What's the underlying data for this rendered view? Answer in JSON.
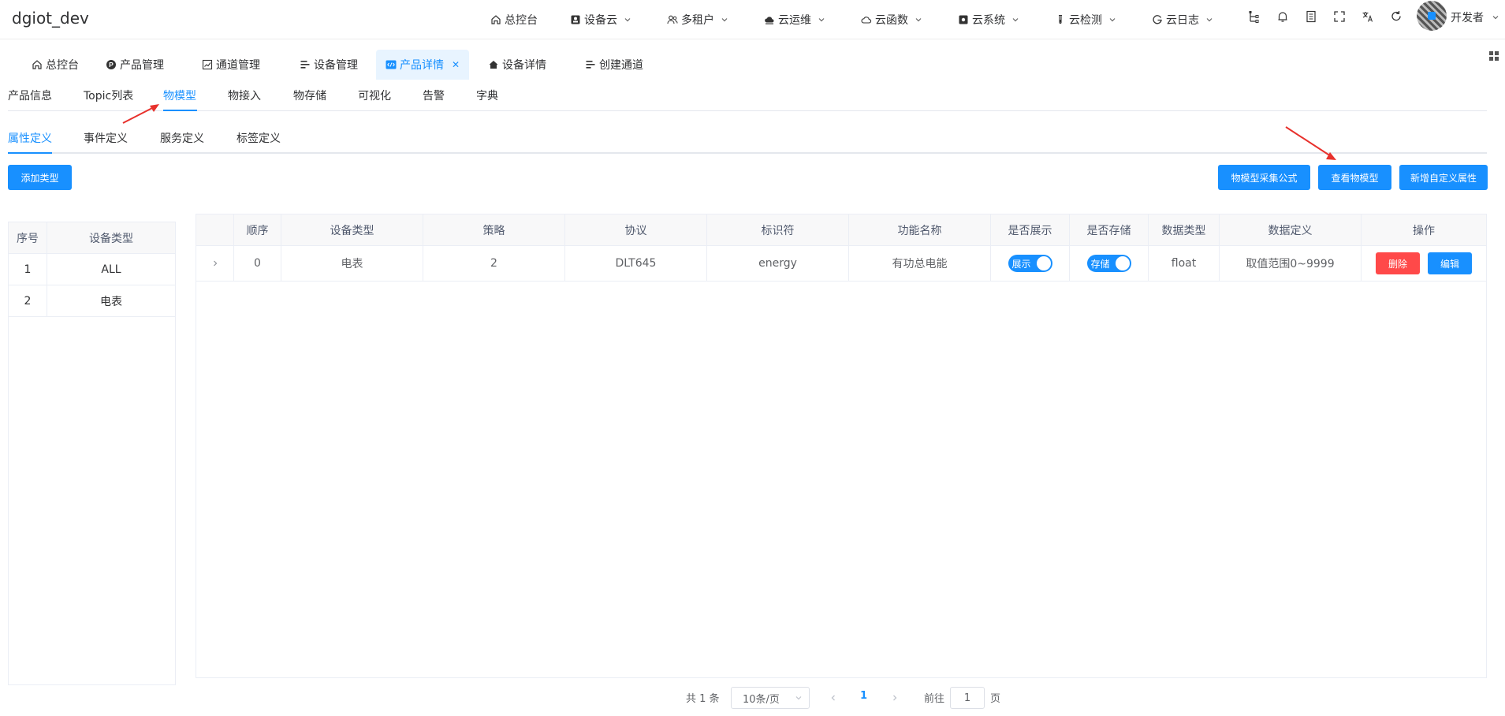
{
  "header": {
    "brand": "dgiot_dev",
    "nav": [
      {
        "label": "总控台",
        "icon": "home-icon",
        "dropdown": false
      },
      {
        "label": "设备云",
        "icon": "device-icon",
        "dropdown": true
      },
      {
        "label": "多租户",
        "icon": "users-icon",
        "dropdown": true
      },
      {
        "label": "云运维",
        "icon": "cloud-ops-icon",
        "dropdown": true
      },
      {
        "label": "云函数",
        "icon": "cloud-icon",
        "dropdown": true
      },
      {
        "label": "云系统",
        "icon": "system-icon",
        "dropdown": true
      },
      {
        "label": "云检测",
        "icon": "test-tube-icon",
        "dropdown": true
      },
      {
        "label": "云日志",
        "icon": "log-icon",
        "dropdown": true
      }
    ],
    "right_icons": [
      "tree-icon",
      "bell-icon",
      "document-icon",
      "fullscreen-icon",
      "translate-icon",
      "refresh-icon"
    ],
    "user": "开发者"
  },
  "tabs_view": [
    {
      "label": "总控台",
      "icon": "home-icon",
      "active": false
    },
    {
      "label": "产品管理",
      "icon": "product-icon",
      "active": false
    },
    {
      "label": "通道管理",
      "icon": "chart-icon",
      "active": false
    },
    {
      "label": "设备管理",
      "icon": "list-icon",
      "active": false
    },
    {
      "label": "产品详情",
      "icon": "code-icon",
      "active": true
    },
    {
      "label": "设备详情",
      "icon": "house-icon",
      "active": false
    },
    {
      "label": "创建通道",
      "icon": "list-icon",
      "active": false
    }
  ],
  "main_tabs": [
    "产品信息",
    "Topic列表",
    "物模型",
    "物接入",
    "物存储",
    "可视化",
    "告警",
    "字典"
  ],
  "active_main_tab": "物模型",
  "sub_tabs": [
    "属性定义",
    "事件定义",
    "服务定义",
    "标签定义"
  ],
  "active_sub_tab": "属性定义",
  "buttons": {
    "add_type": "添加类型",
    "collect_formula": "物模型采集公式",
    "view_model": "查看物模型",
    "add_custom_prop": "新增自定义属性"
  },
  "left_table": {
    "headers": [
      "序号",
      "设备类型"
    ],
    "rows": [
      [
        "1",
        "ALL"
      ],
      [
        "2",
        "电表"
      ]
    ]
  },
  "main_table": {
    "headers": [
      "",
      "顺序",
      "设备类型",
      "策略",
      "协议",
      "标识符",
      "功能名称",
      "是否展示",
      "是否存储",
      "数据类型",
      "数据定义",
      "操作"
    ],
    "rows": [
      {
        "order": "0",
        "device_type": "电表",
        "strategy": "2",
        "protocol": "DLT645",
        "identifier": "energy",
        "name": "有功总电能",
        "show_label": "展示",
        "store_label": "存储",
        "data_type": "float",
        "definition": "取值范围0~9999",
        "delete": "删除",
        "edit": "编辑"
      }
    ]
  },
  "pagination": {
    "total": "共 1 条",
    "page_size": "10条/页",
    "current": "1",
    "goto_label": "前往",
    "goto_value": "1",
    "page_suffix": "页"
  },
  "colors": {
    "primary": "#1890ff",
    "danger": "#ff4949",
    "annotation_arrow": "#e8312c"
  }
}
